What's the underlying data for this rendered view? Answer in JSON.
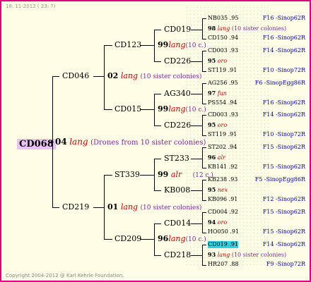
{
  "header": "18. 11-2012 ( 23: 7)",
  "footer": "Copyright 2004-2012 @ Karl Kehrle Foundation.",
  "root": {
    "id": "CD068",
    "num": "04",
    "lang": "lang",
    "note": "(Drones from 10 sister colonies)"
  },
  "gen1": [
    {
      "id": "CD046",
      "num": "02",
      "lang": "lang",
      "note": "(10 sister colonies)"
    },
    {
      "id": "CD219",
      "num": "01",
      "lang": "lang",
      "note": "(10 sister colonies)"
    }
  ],
  "gen2": [
    {
      "id": "CD123",
      "num": "99",
      "lang": "lang",
      "note": "(10 c.)"
    },
    {
      "id": "CD015",
      "num": "99",
      "lang": "lang",
      "note": "(10 c.)"
    },
    {
      "id": "ST339",
      "num": "99",
      "lang": "alr",
      "note": "(12 c.)"
    },
    {
      "id": "CD209",
      "num": "96",
      "lang": "lang",
      "note": "(10 c.)"
    }
  ],
  "gen3": [
    "CD019",
    "CD226",
    "AG340",
    "CD226",
    "ST233",
    "KB008",
    "CD014",
    "CD218"
  ],
  "gen4": [
    {
      "id": "NB035",
      "val": ".95",
      "right": "F16 -Sinop62R"
    },
    {
      "num": "98",
      "tag": "lang",
      "note": "(10 sister colonies)"
    },
    {
      "id": "CD150",
      "val": ".94",
      "right": "F16 -Sinop62R"
    },
    {
      "id": "CD003",
      "val": ".93",
      "right": "F14 -Sinop62R"
    },
    {
      "num": "95",
      "tag": "oro"
    },
    {
      "id": "ST119",
      "val": ".91",
      "right": "F10 -Sinop72R"
    },
    {
      "id": "AG256",
      "val": ".95",
      "right": "F6 -SinopEgg86R"
    },
    {
      "num": "97",
      "tag": "fun"
    },
    {
      "id": "PS554",
      "val": ".94",
      "right": "F16 -Sinop62R"
    },
    {
      "id": "CD003",
      "val": ".93",
      "right": "F14 -Sinop62R"
    },
    {
      "num": "95",
      "tag": "oro"
    },
    {
      "id": "ST119",
      "val": ".91",
      "right": "F10 -Sinop72R"
    },
    {
      "id": "ST202",
      "val": ".94",
      "right": "F15 -Sinop62R"
    },
    {
      "num": "96",
      "tag": "alr"
    },
    {
      "id": "KB141",
      "val": ".92",
      "right": "F15 -Sinop62R"
    },
    {
      "id": "KB238",
      "val": ".93",
      "right": "F5 -SinopEgg86R"
    },
    {
      "num": "95",
      "tag": "nex"
    },
    {
      "id": "KB096",
      "val": ".91",
      "right": "F12 -Sinop62R"
    },
    {
      "id": "CD004",
      "val": ".92",
      "right": "F15 -Sinop62R"
    },
    {
      "num": "94",
      "tag": "oro"
    },
    {
      "id": "HO050",
      "val": ".91",
      "right": "F15 -Sinop62R"
    },
    {
      "id": "CD019",
      "val": ".91",
      "right": "F14 -Sinop62R"
    },
    {
      "num": "93",
      "tag": "lang",
      "note": "(10 sister colonies)"
    },
    {
      "id": "HR207",
      "val": ".88",
      "right": "F9 -Sinop72R"
    }
  ]
}
